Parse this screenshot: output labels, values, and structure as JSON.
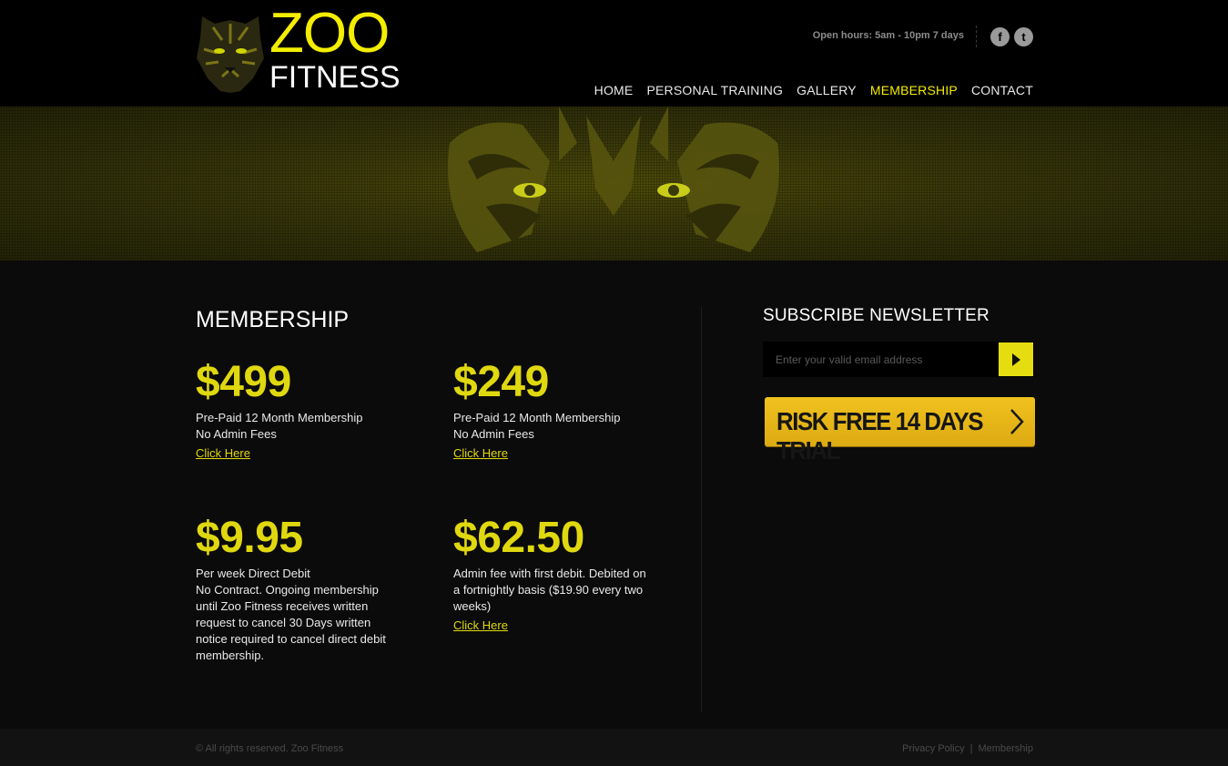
{
  "brand": {
    "word1": "ZOO",
    "word2": "FITNESS"
  },
  "header": {
    "hours": "Open hours: 5am - 10pm 7 days",
    "social": [
      {
        "icon": "facebook-icon",
        "glyph": "f"
      },
      {
        "icon": "twitter-icon",
        "glyph": "t"
      }
    ]
  },
  "nav": {
    "items": [
      "HOME",
      "PERSONAL TRAINING",
      "GALLERY",
      "MEMBERSHIP",
      "CONTACT"
    ],
    "active": "MEMBERSHIP"
  },
  "colors": {
    "accent": "#f3ed00",
    "price": "#e0d80f",
    "button": "#e6dd11",
    "trial": "#e8b819"
  },
  "main": {
    "title": "MEMBERSHIP",
    "plans": [
      {
        "price": "$499",
        "description": "Pre-Paid 12 Month Membership\nNo Admin Fees",
        "link": "Click Here"
      },
      {
        "price": "$249",
        "description": "Pre-Paid 12 Month Membership\nNo Admin Fees",
        "link": "Click Here"
      },
      {
        "price": "$9.95",
        "description": "Per week Direct Debit\nNo Contract. Ongoing membership until Zoo Fitness receives written request to cancel 30 Days written notice required to cancel direct debit membership.",
        "link": ""
      },
      {
        "price": "$62.50",
        "description": "Admin fee with first debit. Debited on a fortnightly basis ($19.90 every two weeks)",
        "link": "Click Here"
      }
    ]
  },
  "sidebar": {
    "newsletter_title": "SUBSCRIBE NEWSLETTER",
    "email_placeholder": "Enter your valid email address",
    "trial_label": "RISK FREE 14 DAYS TRIAL"
  },
  "footer": {
    "copyright": "© All rights reserved. Zoo Fitness",
    "links": [
      "Privacy Policy",
      "Membership"
    ],
    "separator": "|"
  }
}
